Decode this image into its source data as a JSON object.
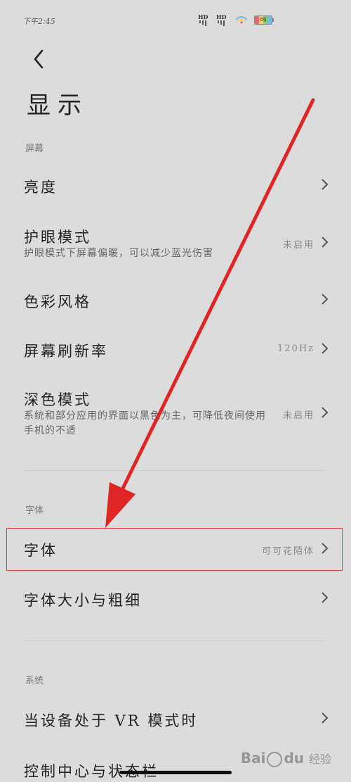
{
  "status_bar": {
    "time": "下午2:45",
    "sim1": "HD",
    "sim2": "HD",
    "battery_text": "86"
  },
  "header": {
    "title": "显示"
  },
  "sections": {
    "screen": "屏幕",
    "font": "字体",
    "system": "系统"
  },
  "items": {
    "brightness": {
      "label": "亮度"
    },
    "eye_care": {
      "label": "护眼模式",
      "subtitle": "护眼模式下屏幕偏暖，可以减少蓝光伤害",
      "value": "未启用"
    },
    "color_style": {
      "label": "色彩风格"
    },
    "refresh_rate": {
      "label": "屏幕刷新率",
      "value": "120Hz"
    },
    "dark_mode": {
      "label": "深色模式",
      "subtitle": "系统和部分应用的界面以黑色为主，可降低夜间使用手机的不适",
      "value": "未启用"
    },
    "font": {
      "label": "字体",
      "value": "可可花陌体"
    },
    "font_size": {
      "label": "字体大小与粗细"
    },
    "vr_mode": {
      "label": "当设备处于 VR 模式时"
    },
    "partial": {
      "label": "控制中心与状态栏"
    }
  },
  "watermark": {
    "brand": "Bai",
    "brand2": "du",
    "suffix": "经验"
  },
  "colors": {
    "background": "#dcdcdc",
    "annotation_red": "#e02525"
  },
  "icons": [
    "chevron-left-icon",
    "chevron-right-icon",
    "wifi-icon",
    "battery-icon",
    "signal-icon"
  ]
}
